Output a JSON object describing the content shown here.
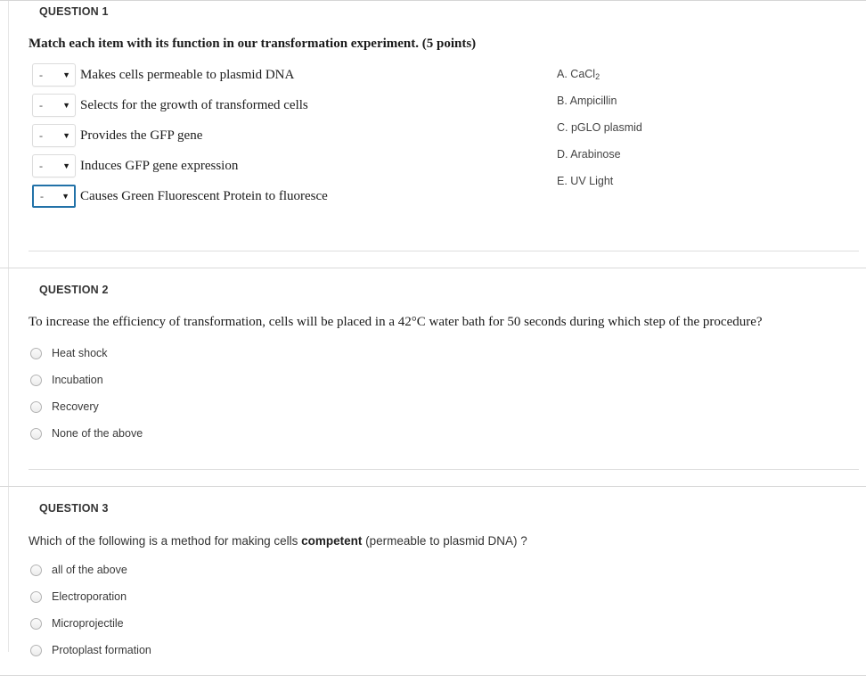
{
  "questions": [
    {
      "header": "QUESTION 1",
      "prompt": "Match each item with its function in our transformation experiment. (5 points)",
      "type": "matching",
      "select_value": "-",
      "select_arrow": "▼",
      "items": [
        {
          "label": "Makes cells permeable to plasmid DNA",
          "value": "-",
          "focused": false
        },
        {
          "label": "Selects for the growth of transformed cells",
          "value": "-",
          "focused": false
        },
        {
          "label": "Provides the GFP gene",
          "value": "-",
          "focused": false
        },
        {
          "label": "Induces GFP gene expression",
          "value": "-",
          "focused": false
        },
        {
          "label": "Causes Green Fluorescent Protein to fluoresce",
          "value": "-",
          "focused": true
        }
      ],
      "answer_key": [
        {
          "letter": "A.",
          "text": "CaCl",
          "sub": "2"
        },
        {
          "letter": "B.",
          "text": "Ampicillin",
          "sub": ""
        },
        {
          "letter": "C.",
          "text": "pGLO plasmid",
          "sub": ""
        },
        {
          "letter": "D.",
          "text": "Arabinose",
          "sub": ""
        },
        {
          "letter": "E.",
          "text": "UV Light",
          "sub": ""
        }
      ]
    },
    {
      "header": "QUESTION 2",
      "prompt": "To increase the efficiency of transformation, cells will be placed in a 42°C water bath for 50 seconds during which step of the procedure?",
      "type": "radio",
      "options": [
        {
          "label": "Heat shock",
          "selected": false
        },
        {
          "label": "Incubation",
          "selected": false
        },
        {
          "label": "Recovery",
          "selected": false
        },
        {
          "label": "None of the above",
          "selected": false
        }
      ]
    },
    {
      "header": "QUESTION 3",
      "prompt_parts": {
        "before": "Which of the following is a method for making cells ",
        "bold": "competent",
        "after": " (permeable to plasmid DNA) ?"
      },
      "type": "radio",
      "options": [
        {
          "label": "all of the above",
          "selected": false
        },
        {
          "label": "Electroporation",
          "selected": false
        },
        {
          "label": "Microprojectile",
          "selected": false
        },
        {
          "label": "Protoplast formation",
          "selected": false
        }
      ]
    }
  ],
  "colors": {
    "focus_border": "#2272a8",
    "divider": "#d9d9d9",
    "text": "#2b2b2b"
  }
}
